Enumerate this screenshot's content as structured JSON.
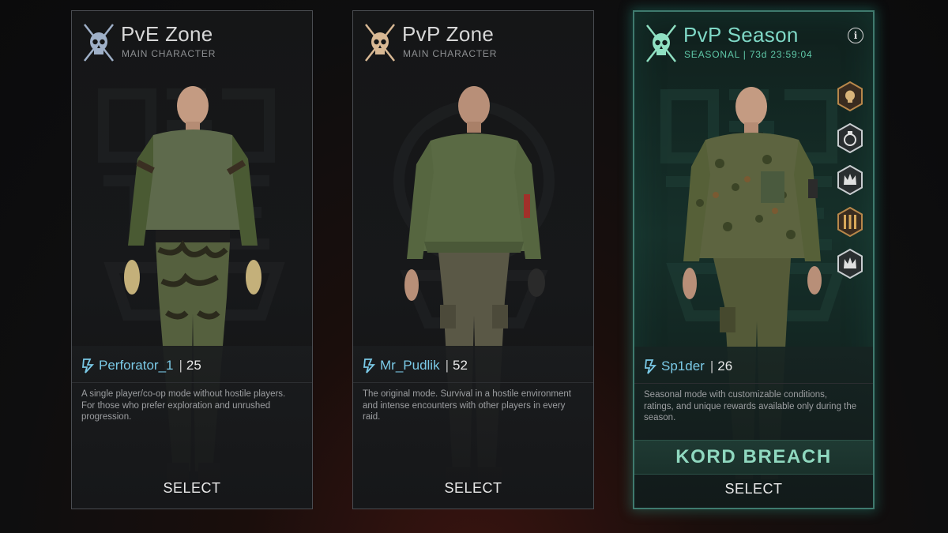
{
  "cards": [
    {
      "title": "PvE Zone",
      "subtitle": "MAIN CHARACTER",
      "player_name": "Perforator_1",
      "level_sep": "|",
      "level": "25",
      "description": "A single player/co-op mode without hostile players. For those who prefer exploration and unrushed progression.",
      "select_label": "SELECT",
      "skull_color": "#9fb0c8",
      "outfit": "woodland-camo"
    },
    {
      "title": "PvP Zone",
      "subtitle": "MAIN CHARACTER",
      "player_name": "Mr_Pudlik",
      "level_sep": "|",
      "level": "52",
      "description": "The original mode. Survival in a hostile environment and intense encounters with other players in every raid.",
      "select_label": "SELECT",
      "skull_color": "#d8b894",
      "outfit": "green-bomber"
    },
    {
      "title": "PvP Season",
      "subtitle": "SEASONAL | 73d 23:59:04",
      "player_name": "Sp1der",
      "level_sep": "|",
      "level": "26",
      "description": "Seasonal mode with customizable conditions, ratings, and unique rewards available only during the season.",
      "season_name": "KORD BREACH",
      "select_label": "SELECT",
      "skull_color": "#8fe0c2",
      "outfit": "flecktarn-fleece",
      "info_icon": "i",
      "badges": [
        "skull-badge-icon",
        "grenade-badge-icon",
        "crown-badge-icon",
        "bars-badge-icon",
        "crown-badge-icon"
      ]
    }
  ],
  "colors": {
    "accent_teal": "#5fc8a8",
    "player_name_blue": "#7ac9e6",
    "active_border": "#3f7a6e"
  }
}
